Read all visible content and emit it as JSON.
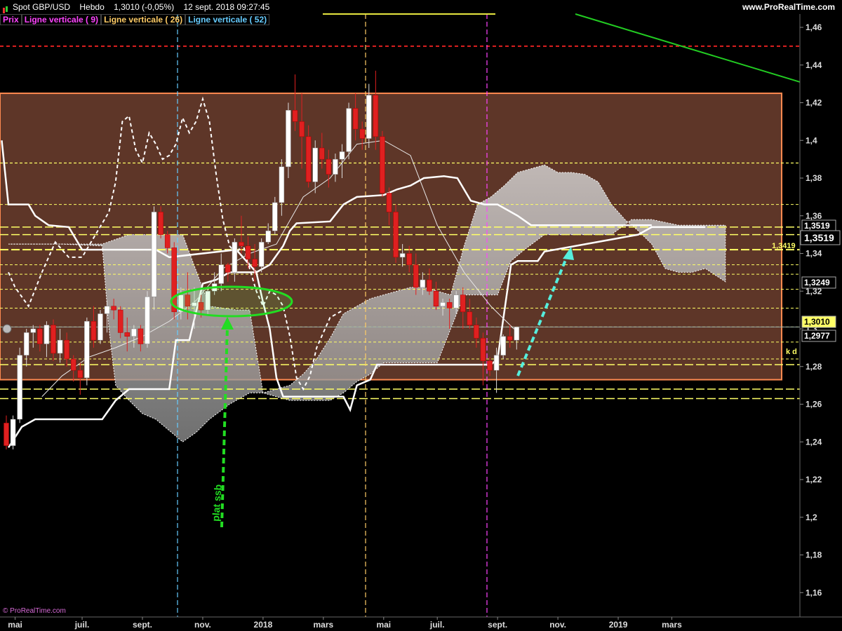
{
  "header": {
    "instrument": "Spot GBP/USD",
    "period": "Hebdo",
    "last": "1,3010 (-0,05%)",
    "datetime": "12 sept. 2018 09:27:45",
    "site": "www.ProRealTime.com"
  },
  "legend": [
    {
      "label": "Prix",
      "color": "#ff44ff"
    },
    {
      "label": "Ligne verticale ( 9)",
      "color": "#ff44ff"
    },
    {
      "label": "Ligne verticale ( 26)",
      "color": "#ffcc66"
    },
    {
      "label": "Ligne verticale ( 52)",
      "color": "#66ccff"
    }
  ],
  "copyright": "© ProRealTime.com",
  "annotations": {
    "plat_ssb": "plat ssb",
    "kd": "k d"
  },
  "price_tags": [
    {
      "value": "1,3519",
      "style": "box"
    },
    {
      "value": "1,3519",
      "style": "big"
    },
    {
      "value": "1,3419",
      "style": "yellow"
    },
    {
      "value": "1,3249",
      "style": "box"
    },
    {
      "value": "1,3010",
      "style": "current"
    },
    {
      "value": "1,2977",
      "style": "box"
    }
  ],
  "chart_data": {
    "type": "candlestick",
    "title": "Spot GBP/USD",
    "ylim": [
      1.15,
      1.47
    ],
    "yticks": [
      "1,46",
      "1,44",
      "1,42",
      "1,4",
      "1,38",
      "1,36",
      "1,34",
      "1,32",
      "1,3",
      "1,28",
      "1,26",
      "1,24",
      "1,22",
      "1,2",
      "1,18",
      "1,16"
    ],
    "xticks": [
      {
        "label": "mai",
        "w": 1
      },
      {
        "label": "juil.",
        "w": 11
      },
      {
        "label": "sept.",
        "w": 20
      },
      {
        "label": "nov.",
        "w": 29
      },
      {
        "label": "2018",
        "w": 38
      },
      {
        "label": "mars",
        "w": 47
      },
      {
        "label": "mai",
        "w": 56
      },
      {
        "label": "juil.",
        "w": 64
      },
      {
        "label": "sept.",
        "w": 73
      },
      {
        "label": "nov.",
        "w": 82
      },
      {
        "label": "2019",
        "w": 91
      },
      {
        "label": "mars",
        "w": 99
      }
    ],
    "candles": [
      [
        1.25,
        1.254,
        1.236,
        1.238
      ],
      [
        1.238,
        1.254,
        1.236,
        1.252
      ],
      [
        1.252,
        1.29,
        1.25,
        1.286
      ],
      [
        1.286,
        1.3,
        1.28,
        1.298
      ],
      [
        1.298,
        1.302,
        1.29,
        1.3
      ],
      [
        1.3,
        1.302,
        1.288,
        1.292
      ],
      [
        1.292,
        1.304,
        1.285,
        1.302
      ],
      [
        1.302,
        1.305,
        1.283,
        1.287
      ],
      [
        1.287,
        1.3,
        1.282,
        1.294
      ],
      [
        1.294,
        1.298,
        1.28,
        1.284
      ],
      [
        1.284,
        1.286,
        1.272,
        1.278
      ],
      [
        1.278,
        1.282,
        1.265,
        1.274
      ],
      [
        1.274,
        1.306,
        1.27,
        1.304
      ],
      [
        1.304,
        1.312,
        1.29,
        1.294
      ],
      [
        1.294,
        1.31,
        1.292,
        1.308
      ],
      [
        1.308,
        1.315,
        1.298,
        1.312
      ],
      [
        1.312,
        1.316,
        1.305,
        1.31
      ],
      [
        1.31,
        1.312,
        1.295,
        1.298
      ],
      [
        1.298,
        1.306,
        1.288,
        1.296
      ],
      [
        1.296,
        1.302,
        1.29,
        1.3
      ],
      [
        1.3,
        1.302,
        1.288,
        1.292
      ],
      [
        1.292,
        1.32,
        1.29,
        1.317
      ],
      [
        1.317,
        1.365,
        1.31,
        1.362
      ],
      [
        1.362,
        1.365,
        1.348,
        1.35
      ],
      [
        1.35,
        1.352,
        1.34,
        1.343
      ],
      [
        1.343,
        1.346,
        1.305,
        1.309
      ],
      [
        1.309,
        1.322,
        1.305,
        1.318
      ],
      [
        1.318,
        1.33,
        1.305,
        1.312
      ],
      [
        1.312,
        1.322,
        1.3,
        1.314
      ],
      [
        1.314,
        1.318,
        1.306,
        1.31
      ],
      [
        1.31,
        1.322,
        1.307,
        1.32
      ],
      [
        1.32,
        1.33,
        1.318,
        1.324
      ],
      [
        1.324,
        1.34,
        1.32,
        1.334
      ],
      [
        1.334,
        1.335,
        1.325,
        1.33
      ],
      [
        1.33,
        1.348,
        1.325,
        1.346
      ],
      [
        1.346,
        1.36,
        1.34,
        1.344
      ],
      [
        1.344,
        1.349,
        1.332,
        1.337
      ],
      [
        1.337,
        1.345,
        1.325,
        1.333
      ],
      [
        1.333,
        1.348,
        1.33,
        1.346
      ],
      [
        1.346,
        1.356,
        1.345,
        1.352
      ],
      [
        1.352,
        1.37,
        1.35,
        1.367
      ],
      [
        1.367,
        1.39,
        1.36,
        1.386
      ],
      [
        1.386,
        1.42,
        1.38,
        1.416
      ],
      [
        1.416,
        1.435,
        1.405,
        1.41
      ],
      [
        1.41,
        1.425,
        1.385,
        1.402
      ],
      [
        1.402,
        1.408,
        1.375,
        1.378
      ],
      [
        1.378,
        1.4,
        1.372,
        1.396
      ],
      [
        1.396,
        1.404,
        1.385,
        1.39
      ],
      [
        1.39,
        1.395,
        1.375,
        1.382
      ],
      [
        1.382,
        1.393,
        1.378,
        1.39
      ],
      [
        1.39,
        1.398,
        1.38,
        1.394
      ],
      [
        1.394,
        1.42,
        1.39,
        1.417
      ],
      [
        1.417,
        1.425,
        1.4,
        1.406
      ],
      [
        1.406,
        1.41,
        1.395,
        1.401
      ],
      [
        1.401,
        1.43,
        1.396,
        1.424
      ],
      [
        1.424,
        1.437,
        1.395,
        1.402
      ],
      [
        1.402,
        1.405,
        1.37,
        1.372
      ],
      [
        1.372,
        1.375,
        1.355,
        1.362
      ],
      [
        1.362,
        1.366,
        1.335,
        1.338
      ],
      [
        1.338,
        1.345,
        1.333,
        1.34
      ],
      [
        1.34,
        1.344,
        1.33,
        1.334
      ],
      [
        1.334,
        1.34,
        1.318,
        1.322
      ],
      [
        1.322,
        1.33,
        1.318,
        1.326
      ],
      [
        1.326,
        1.332,
        1.318,
        1.32
      ],
      [
        1.32,
        1.325,
        1.31,
        1.312
      ],
      [
        1.312,
        1.316,
        1.307,
        1.314
      ],
      [
        1.314,
        1.316,
        1.3,
        1.311
      ],
      [
        1.311,
        1.32,
        1.308,
        1.318
      ],
      [
        1.318,
        1.322,
        1.3,
        1.309
      ],
      [
        1.309,
        1.316,
        1.3,
        1.302
      ],
      [
        1.302,
        1.306,
        1.29,
        1.295
      ],
      [
        1.295,
        1.298,
        1.27,
        1.283
      ],
      [
        1.283,
        1.285,
        1.275,
        1.278
      ],
      [
        1.278,
        1.29,
        1.266,
        1.286
      ],
      [
        1.286,
        1.297,
        1.284,
        1.296
      ],
      [
        1.296,
        1.302,
        1.29,
        1.294
      ],
      [
        1.294,
        1.3,
        1.289,
        1.301
      ]
    ]
  }
}
